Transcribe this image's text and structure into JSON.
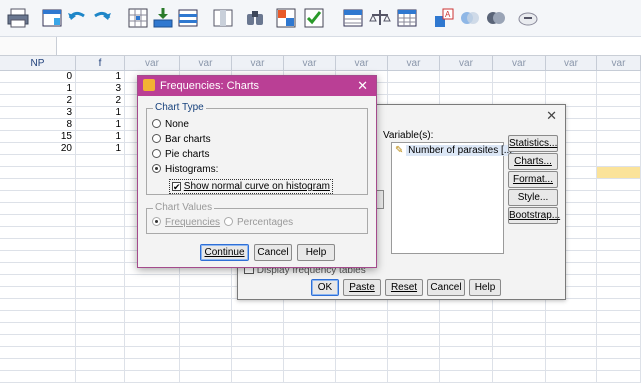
{
  "toolbar": {
    "icons": [
      "print-icon",
      "data-editor-icon",
      "undo-icon",
      "redo-icon",
      "goto-case-icon",
      "insert-cases-icon",
      "insert-variable-icon",
      "split-file-icon",
      "find-icon",
      "weight-cases-icon",
      "select-cases-icon",
      "value-labels-icon",
      "scale-icon",
      "grid-icon",
      "use-sets-icon",
      "show-all-variables-icon",
      "circle-icon",
      "spell-check-icon"
    ]
  },
  "grid": {
    "columns": [
      "NP",
      "f",
      "var",
      "var",
      "var",
      "var",
      "var",
      "var",
      "var",
      "var",
      "var",
      "var"
    ],
    "rows": [
      [
        "0",
        "1"
      ],
      [
        "1",
        "3"
      ],
      [
        "2",
        "2"
      ],
      [
        "3",
        "1"
      ],
      [
        "8",
        "1"
      ],
      [
        "15",
        "1"
      ],
      [
        "20",
        "1"
      ]
    ]
  },
  "frequencies_dialog": {
    "variables_label": "Variable(s):",
    "variable_item": "Number of parasites [...",
    "side_buttons": [
      "Statistics...",
      "Charts...",
      "Format...",
      "Style...",
      "Bootstrap..."
    ],
    "display_tables_label": "Display frequency tables",
    "bottom_buttons": [
      "OK",
      "Paste",
      "Reset",
      "Cancel",
      "Help"
    ]
  },
  "charts_dialog": {
    "title": "Frequencies: Charts",
    "chart_type_legend": "Chart Type",
    "options": [
      "None",
      "Bar charts",
      "Pie charts",
      "Histograms:"
    ],
    "show_normal_label": "Show normal curve on histogram",
    "chart_values_legend": "Chart Values",
    "values_frequencies": "Frequencies",
    "values_percentages": "Percentages",
    "buttons": [
      "Continue",
      "Cancel",
      "Help"
    ]
  }
}
